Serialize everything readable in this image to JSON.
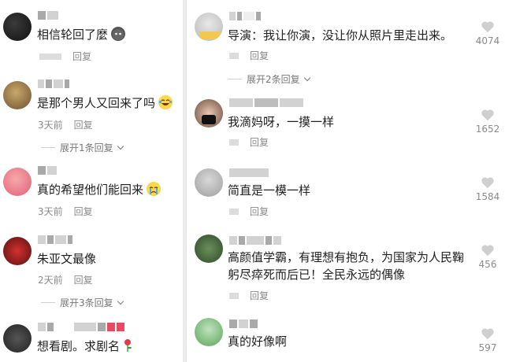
{
  "left": {
    "comments": [
      {
        "text": "相信轮回了麼",
        "date": "",
        "reply": "回复",
        "emoji": "cat-face"
      },
      {
        "text": "是那个男人又回来了吗",
        "date": "3天前",
        "reply": "回复",
        "emoji": "laughing-tears",
        "expand": "展开1条回复"
      },
      {
        "text": "真的希望他们能回来",
        "date": "3天前",
        "reply": "回复",
        "emoji": "crying-face"
      },
      {
        "text": "朱亚文最像",
        "date": "2天前",
        "reply": "回复",
        "expand": "展开3条回复"
      },
      {
        "text": "想看剧。求剧名",
        "emoji": "rose"
      }
    ]
  },
  "right": {
    "comments": [
      {
        "text": "导演：我让你演，没让你从照片里走出来。",
        "reply": "回复",
        "likes": "4074",
        "expand": "展开2条回复"
      },
      {
        "text": "我滴妈呀，一摸一样",
        "reply": "回复",
        "likes": "1652",
        "username_visible": "ggle"
      },
      {
        "text": "简直是一模一样",
        "reply": "回复",
        "likes": "1584"
      },
      {
        "text_line1": "高颜值学霸，有理想有抱负，为国家为人民鞠",
        "text_line2": "躬尽瘁死而后已！全民永远的偶像",
        "reply": "回复",
        "likes": "456"
      },
      {
        "text": "真的好像啊",
        "likes": "597"
      }
    ]
  },
  "colors": {
    "accent_like": "#c8c8c8",
    "text": "#1f1f1f",
    "meta": "#8a8a8a"
  }
}
